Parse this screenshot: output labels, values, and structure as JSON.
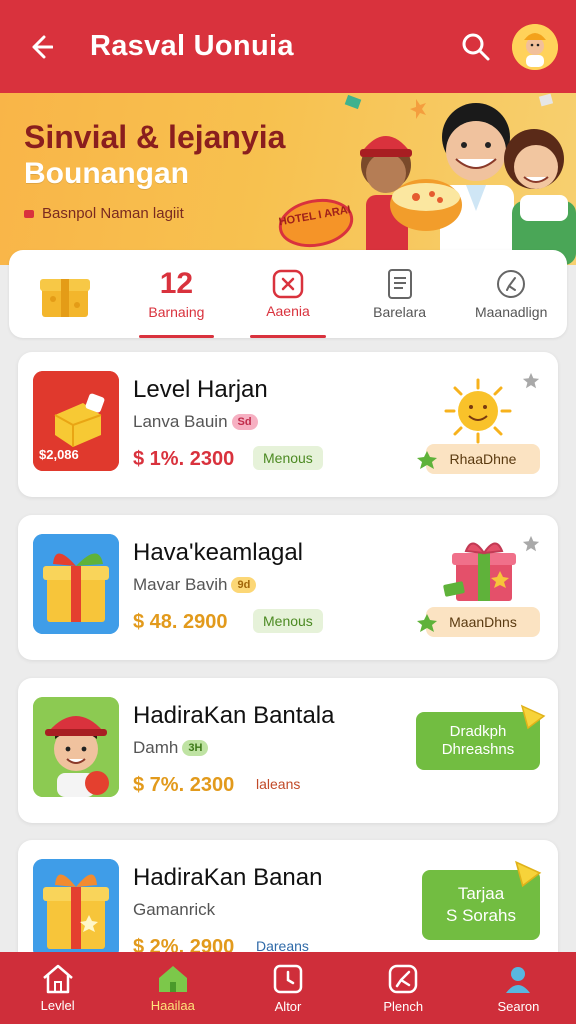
{
  "header": {
    "title": "Rasval Uonuia",
    "back_icon": "back-arrow-icon",
    "search_icon": "search-icon",
    "avatar_icon": "user-avatar-icon"
  },
  "banner": {
    "line1": "Sinvial & lejanyia",
    "line2": "Bounangan",
    "subtitle": "Basnpol Naman lagiit",
    "stamp": "HOTEL I ARAI"
  },
  "tabs": [
    {
      "icon": "gift-box-icon",
      "label": ""
    },
    {
      "number": "12",
      "label": "Barnaing"
    },
    {
      "icon": "close-box-icon",
      "label": "Aaenia",
      "active": true
    },
    {
      "icon": "document-icon",
      "label": "Barelara"
    },
    {
      "icon": "compass-icon",
      "label": "Maanadlign"
    }
  ],
  "cards": [
    {
      "title": "Level Harjan",
      "meta": "Lanva Bauin",
      "badge": "Sd",
      "price": "$ 1%. 2300",
      "chip": "Menous",
      "thumb_price": "$2,086",
      "reward": "RhaaDhne"
    },
    {
      "title": "Hava'keamlagal",
      "meta": "Mavar Bavih",
      "badge": "9d",
      "price": "$ 48. 2900",
      "chip": "Menous",
      "reward": "MaanDhns"
    },
    {
      "title": "HadiraKan Bantala",
      "meta": "Damh",
      "badge": "3H",
      "price": "$ 7%. 2300",
      "chip": "laleans",
      "button": "Dradkph\nDhreashns"
    },
    {
      "title": "HadiraKan Banan",
      "meta": "Gamanrick",
      "price": "$ 2%. 2900",
      "chip": "Dareans",
      "button": "Tarjaa\nS Sorahs"
    }
  ],
  "nav": [
    {
      "label": "Levlel",
      "icon": "home-icon"
    },
    {
      "label": "Haailaa",
      "icon": "home-icon",
      "active": true
    },
    {
      "label": "Altor",
      "icon": "clock-icon"
    },
    {
      "label": "Plench",
      "icon": "compass-icon"
    },
    {
      "label": "Searon",
      "icon": "profile-icon"
    }
  ],
  "colors": {
    "primary": "#d9323d",
    "green": "#72bd41",
    "accent": "#f9b548"
  }
}
